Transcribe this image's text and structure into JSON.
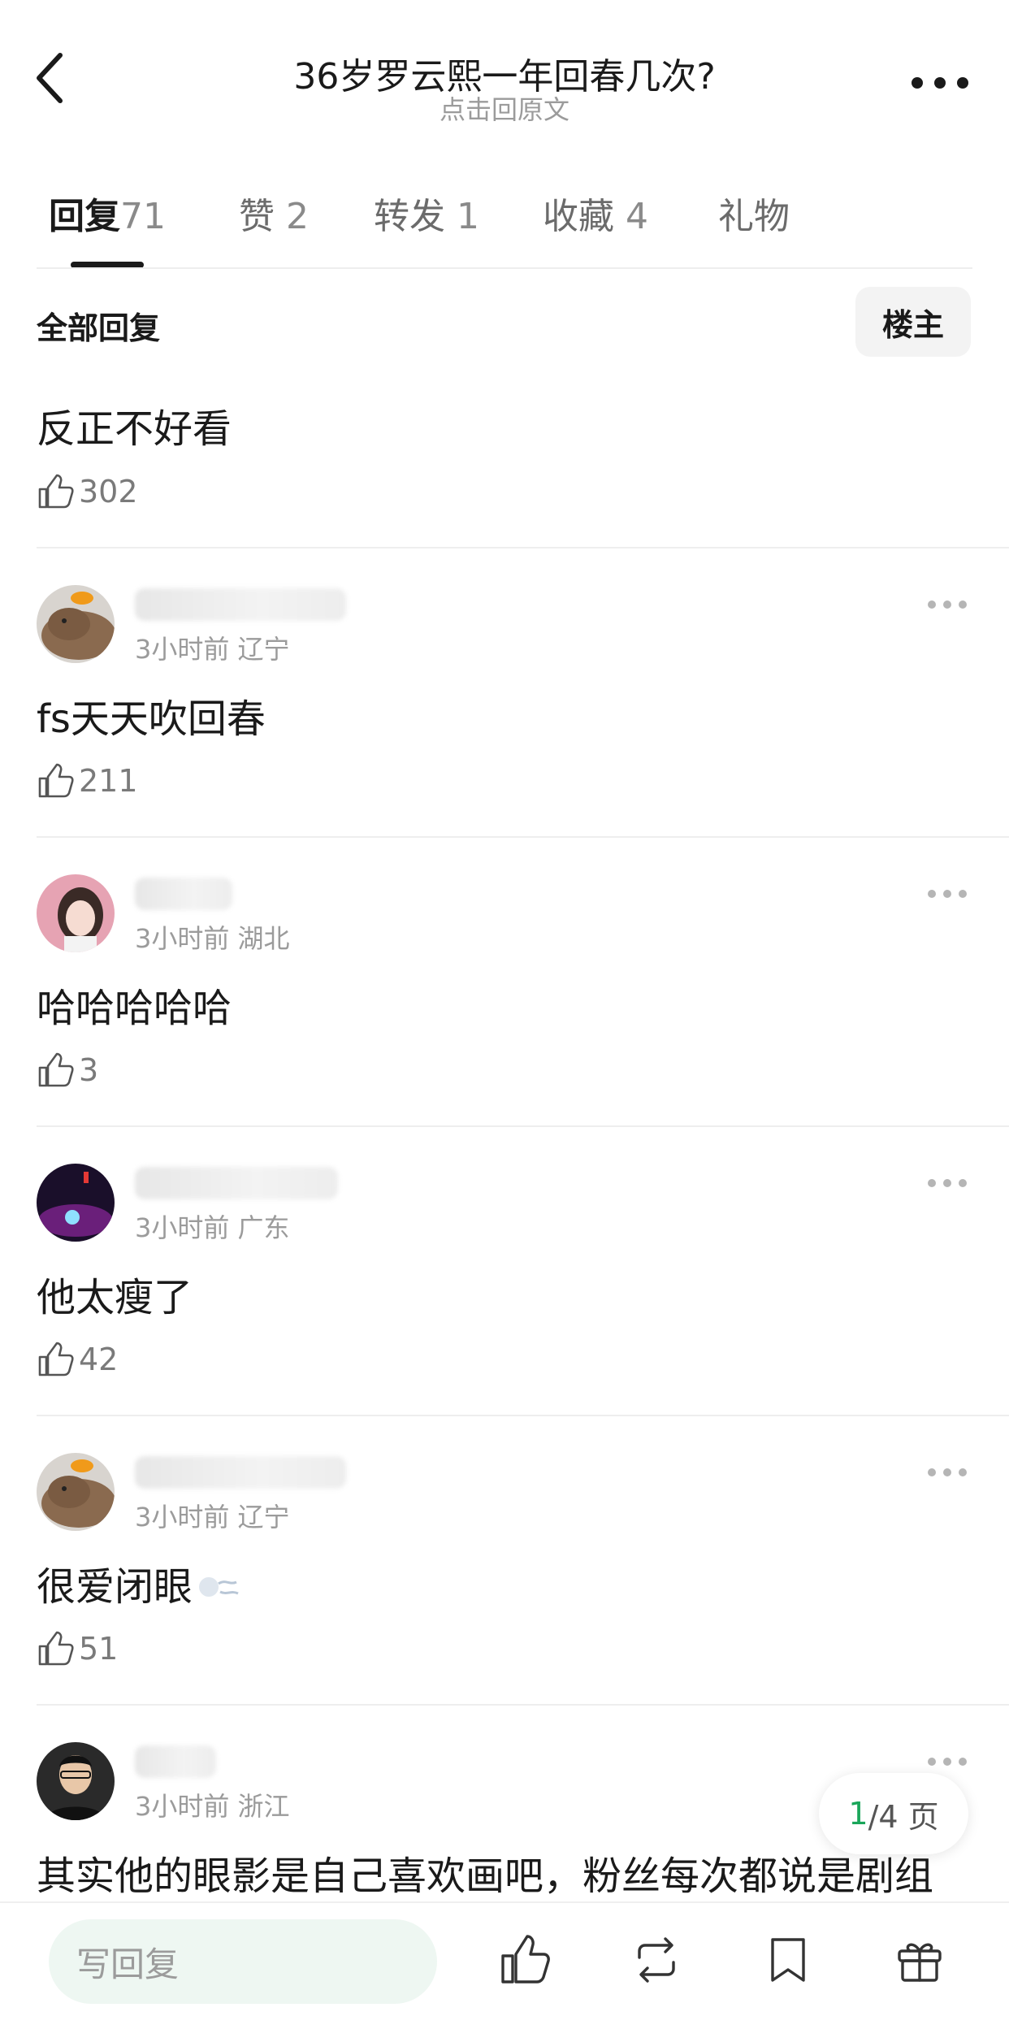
{
  "header": {
    "title": "36岁罗云熙一年回春几次?",
    "subtitle": "点击回原文"
  },
  "tabs": [
    {
      "label": "回复",
      "count": "71",
      "active": true
    },
    {
      "label": "赞",
      "count": "2"
    },
    {
      "label": "转发",
      "count": "1"
    },
    {
      "label": "收藏",
      "count": "4"
    },
    {
      "label": "礼物",
      "count": ""
    }
  ],
  "filter": {
    "all_replies": "全部回复",
    "op_only": "楼主"
  },
  "top_comment": {
    "content": "反正不好看",
    "likes": "302"
  },
  "comments": [
    {
      "meta": "3小时前 辽宁",
      "content": "fs天天吹回春",
      "likes": "211",
      "avatar": "capybara-avatar"
    },
    {
      "meta": "3小时前 湖北",
      "content": "哈哈哈哈哈",
      "likes": "3",
      "avatar": "girl-avatar"
    },
    {
      "meta": "3小时前 广东",
      "content": "他太瘦了",
      "likes": "42",
      "avatar": "stage-avatar"
    },
    {
      "meta": "3小时前 辽宁",
      "content": "很爱闭眼",
      "likes": "51",
      "avatar": "capybara-avatar"
    },
    {
      "meta": "3小时前 浙江",
      "content": "其实他的眼影是自己喜欢画吧，粉丝每次都说是剧组",
      "avatar": "man-avatar"
    }
  ],
  "pager": {
    "current": "1",
    "rest": "/4 页"
  },
  "bottom_bar": {
    "reply_placeholder": "写回复",
    "icons": [
      "like-icon",
      "repost-icon",
      "bookmark-icon",
      "gift-icon"
    ]
  },
  "colors": {
    "accent_green": "#1aa65a",
    "input_bg": "#eef7f2"
  }
}
